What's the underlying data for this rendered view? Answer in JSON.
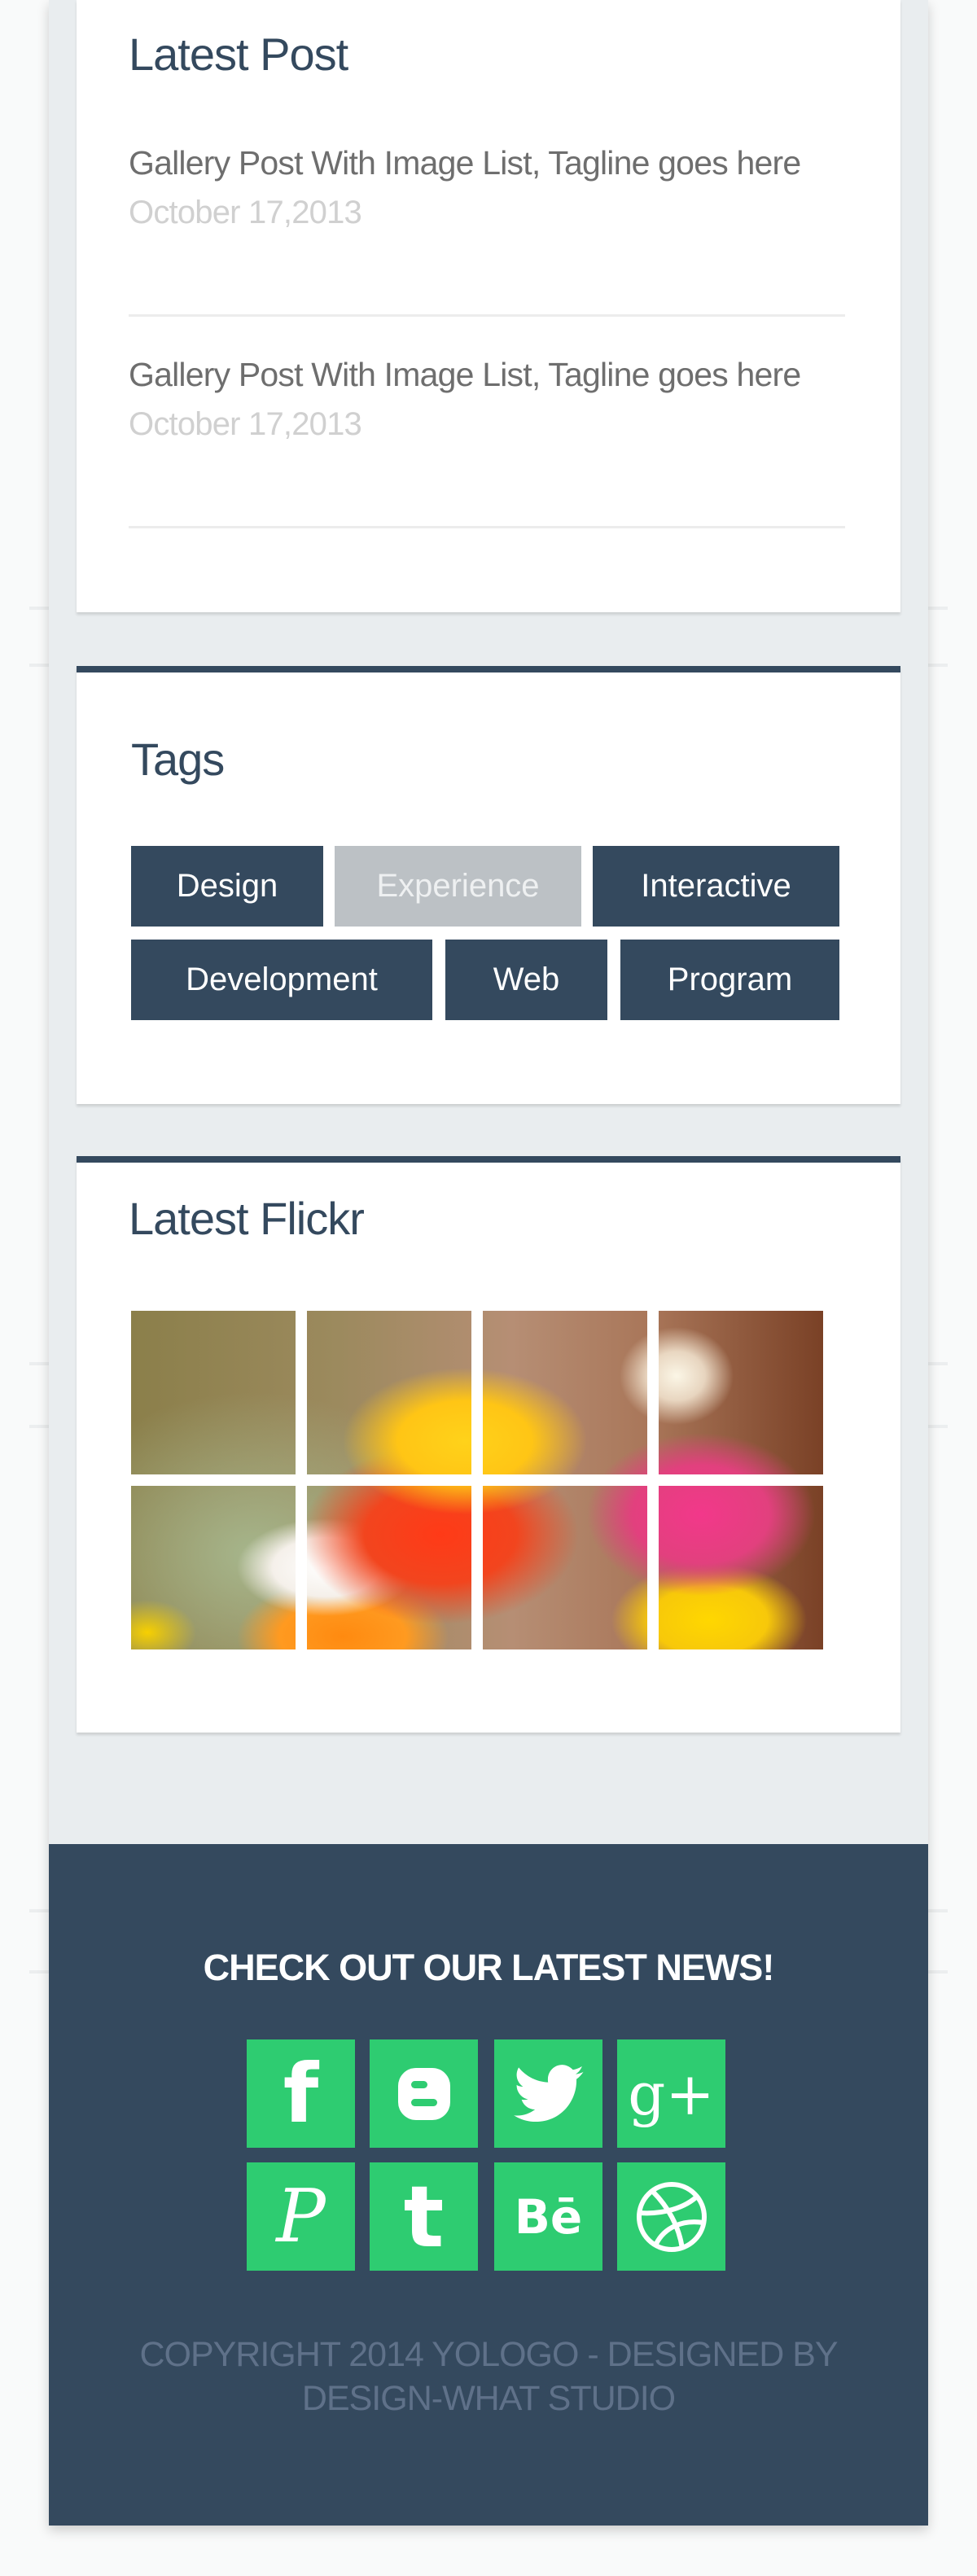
{
  "latest_post": {
    "title": "Latest Post",
    "posts": [
      {
        "title": "Gallery Post With Image List, Tagline goes here",
        "date": "October 17,2013"
      },
      {
        "title": "Gallery Post With Image List, Tagline goes here",
        "date": "October 17,2013"
      }
    ]
  },
  "tags": {
    "title": "Tags",
    "items": [
      {
        "label": "Design",
        "active": true
      },
      {
        "label": "Experience",
        "active": false
      },
      {
        "label": "Interactive",
        "active": true
      },
      {
        "label": "Development",
        "active": true
      },
      {
        "label": "Web",
        "active": true
      },
      {
        "label": "Program",
        "active": true
      }
    ]
  },
  "flickr": {
    "title": "Latest Flickr",
    "image_count": 8
  },
  "footer": {
    "title": "CHECK OUT OUR LATEST NEWS!",
    "social": [
      {
        "icon": "facebook-icon",
        "glyph": "f"
      },
      {
        "icon": "blogger-icon",
        "glyph": ""
      },
      {
        "icon": "twitter-icon",
        "glyph": ""
      },
      {
        "icon": "google-plus-icon",
        "glyph": "g+"
      },
      {
        "icon": "pinterest-icon",
        "glyph": "P"
      },
      {
        "icon": "tumblr-icon",
        "glyph": "t"
      },
      {
        "icon": "behance-icon",
        "glyph": "Bē"
      },
      {
        "icon": "dribbble-icon",
        "glyph": ""
      }
    ],
    "copyright_line1": "COPYRIGHT 2014 YOLOGO - DESIGNED BY",
    "copyright_line2": "DESIGN-WHAT STUDIO"
  },
  "colors": {
    "primary": "#34495e",
    "accent": "#2ecc71",
    "muted_tag": "#bcc1c5",
    "page_bg": "#e9edef"
  }
}
